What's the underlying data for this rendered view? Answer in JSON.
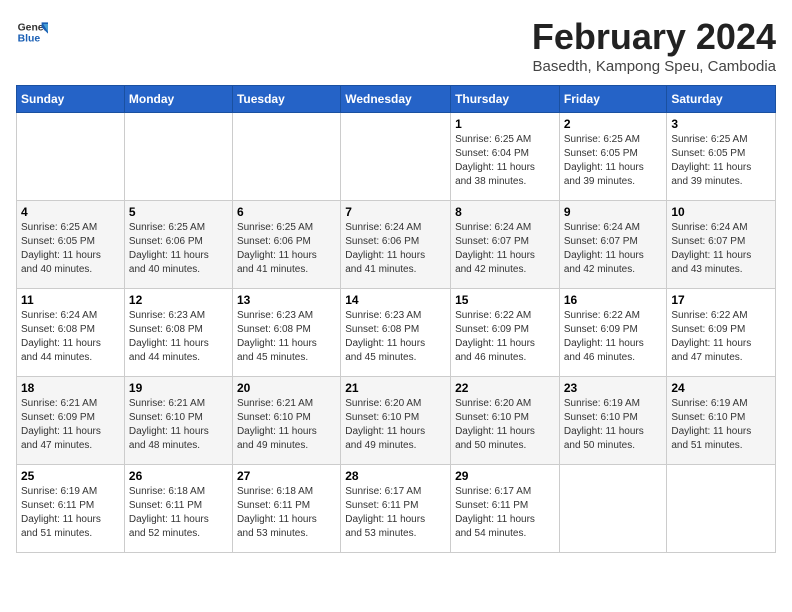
{
  "logo": {
    "line1": "General",
    "line2": "Blue"
  },
  "title": "February 2024",
  "subtitle": "Basedth, Kampong Speu, Cambodia",
  "days_of_week": [
    "Sunday",
    "Monday",
    "Tuesday",
    "Wednesday",
    "Thursday",
    "Friday",
    "Saturday"
  ],
  "weeks": [
    [
      {
        "day": "",
        "info": ""
      },
      {
        "day": "",
        "info": ""
      },
      {
        "day": "",
        "info": ""
      },
      {
        "day": "",
        "info": ""
      },
      {
        "day": "1",
        "info": "Sunrise: 6:25 AM\nSunset: 6:04 PM\nDaylight: 11 hours\nand 38 minutes."
      },
      {
        "day": "2",
        "info": "Sunrise: 6:25 AM\nSunset: 6:05 PM\nDaylight: 11 hours\nand 39 minutes."
      },
      {
        "day": "3",
        "info": "Sunrise: 6:25 AM\nSunset: 6:05 PM\nDaylight: 11 hours\nand 39 minutes."
      }
    ],
    [
      {
        "day": "4",
        "info": "Sunrise: 6:25 AM\nSunset: 6:05 PM\nDaylight: 11 hours\nand 40 minutes."
      },
      {
        "day": "5",
        "info": "Sunrise: 6:25 AM\nSunset: 6:06 PM\nDaylight: 11 hours\nand 40 minutes."
      },
      {
        "day": "6",
        "info": "Sunrise: 6:25 AM\nSunset: 6:06 PM\nDaylight: 11 hours\nand 41 minutes."
      },
      {
        "day": "7",
        "info": "Sunrise: 6:24 AM\nSunset: 6:06 PM\nDaylight: 11 hours\nand 41 minutes."
      },
      {
        "day": "8",
        "info": "Sunrise: 6:24 AM\nSunset: 6:07 PM\nDaylight: 11 hours\nand 42 minutes."
      },
      {
        "day": "9",
        "info": "Sunrise: 6:24 AM\nSunset: 6:07 PM\nDaylight: 11 hours\nand 42 minutes."
      },
      {
        "day": "10",
        "info": "Sunrise: 6:24 AM\nSunset: 6:07 PM\nDaylight: 11 hours\nand 43 minutes."
      }
    ],
    [
      {
        "day": "11",
        "info": "Sunrise: 6:24 AM\nSunset: 6:08 PM\nDaylight: 11 hours\nand 44 minutes."
      },
      {
        "day": "12",
        "info": "Sunrise: 6:23 AM\nSunset: 6:08 PM\nDaylight: 11 hours\nand 44 minutes."
      },
      {
        "day": "13",
        "info": "Sunrise: 6:23 AM\nSunset: 6:08 PM\nDaylight: 11 hours\nand 45 minutes."
      },
      {
        "day": "14",
        "info": "Sunrise: 6:23 AM\nSunset: 6:08 PM\nDaylight: 11 hours\nand 45 minutes."
      },
      {
        "day": "15",
        "info": "Sunrise: 6:22 AM\nSunset: 6:09 PM\nDaylight: 11 hours\nand 46 minutes."
      },
      {
        "day": "16",
        "info": "Sunrise: 6:22 AM\nSunset: 6:09 PM\nDaylight: 11 hours\nand 46 minutes."
      },
      {
        "day": "17",
        "info": "Sunrise: 6:22 AM\nSunset: 6:09 PM\nDaylight: 11 hours\nand 47 minutes."
      }
    ],
    [
      {
        "day": "18",
        "info": "Sunrise: 6:21 AM\nSunset: 6:09 PM\nDaylight: 11 hours\nand 47 minutes."
      },
      {
        "day": "19",
        "info": "Sunrise: 6:21 AM\nSunset: 6:10 PM\nDaylight: 11 hours\nand 48 minutes."
      },
      {
        "day": "20",
        "info": "Sunrise: 6:21 AM\nSunset: 6:10 PM\nDaylight: 11 hours\nand 49 minutes."
      },
      {
        "day": "21",
        "info": "Sunrise: 6:20 AM\nSunset: 6:10 PM\nDaylight: 11 hours\nand 49 minutes."
      },
      {
        "day": "22",
        "info": "Sunrise: 6:20 AM\nSunset: 6:10 PM\nDaylight: 11 hours\nand 50 minutes."
      },
      {
        "day": "23",
        "info": "Sunrise: 6:19 AM\nSunset: 6:10 PM\nDaylight: 11 hours\nand 50 minutes."
      },
      {
        "day": "24",
        "info": "Sunrise: 6:19 AM\nSunset: 6:10 PM\nDaylight: 11 hours\nand 51 minutes."
      }
    ],
    [
      {
        "day": "25",
        "info": "Sunrise: 6:19 AM\nSunset: 6:11 PM\nDaylight: 11 hours\nand 51 minutes."
      },
      {
        "day": "26",
        "info": "Sunrise: 6:18 AM\nSunset: 6:11 PM\nDaylight: 11 hours\nand 52 minutes."
      },
      {
        "day": "27",
        "info": "Sunrise: 6:18 AM\nSunset: 6:11 PM\nDaylight: 11 hours\nand 53 minutes."
      },
      {
        "day": "28",
        "info": "Sunrise: 6:17 AM\nSunset: 6:11 PM\nDaylight: 11 hours\nand 53 minutes."
      },
      {
        "day": "29",
        "info": "Sunrise: 6:17 AM\nSunset: 6:11 PM\nDaylight: 11 hours\nand 54 minutes."
      },
      {
        "day": "",
        "info": ""
      },
      {
        "day": "",
        "info": ""
      }
    ]
  ]
}
